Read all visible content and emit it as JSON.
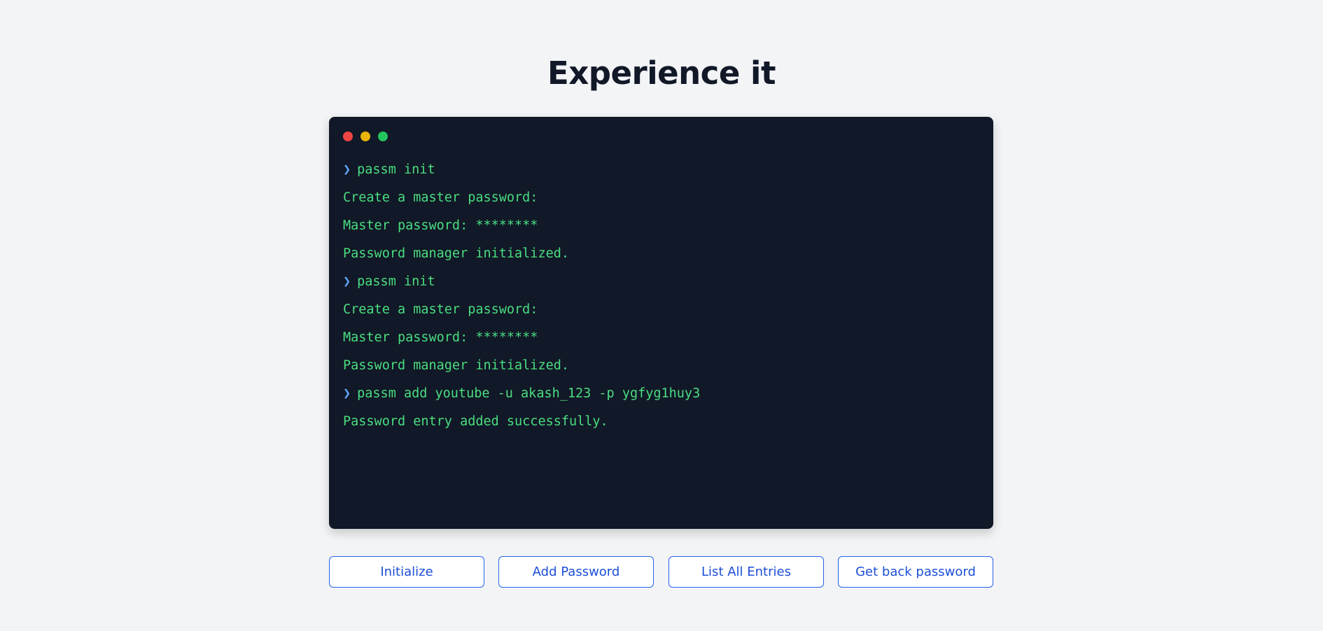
{
  "page": {
    "title": "Experience it"
  },
  "colors": {
    "background": "#f3f4f6",
    "terminal_bg": "#111827",
    "output_text": "#4ade80",
    "prompt_symbol": "#60a5fa",
    "button_border": "#2563eb",
    "button_text": "#1d4ed8",
    "dot_red": "#ef4444",
    "dot_yellow": "#eab308",
    "dot_green": "#22c55e"
  },
  "terminal": {
    "prompt_symbol": "❯",
    "lines": [
      {
        "type": "command",
        "text": "passm init"
      },
      {
        "type": "output",
        "text": "Create a master password:"
      },
      {
        "type": "output",
        "text": "Master password: ********"
      },
      {
        "type": "output",
        "text": "Password manager initialized."
      },
      {
        "type": "command",
        "text": "passm init"
      },
      {
        "type": "output",
        "text": "Create a master password:"
      },
      {
        "type": "output",
        "text": "Master password: ********"
      },
      {
        "type": "output",
        "text": "Password manager initialized."
      },
      {
        "type": "command",
        "text": "passm add youtube -u akash_123 -p ygfyg1huy3"
      },
      {
        "type": "output",
        "text": "Password entry added successfully."
      }
    ]
  },
  "actions": {
    "buttons": [
      {
        "label": "Initialize",
        "name": "initialize-button"
      },
      {
        "label": "Add Password",
        "name": "add-password-button"
      },
      {
        "label": "List All Entries",
        "name": "list-all-entries-button"
      },
      {
        "label": "Get back password",
        "name": "get-back-password-button"
      }
    ]
  }
}
